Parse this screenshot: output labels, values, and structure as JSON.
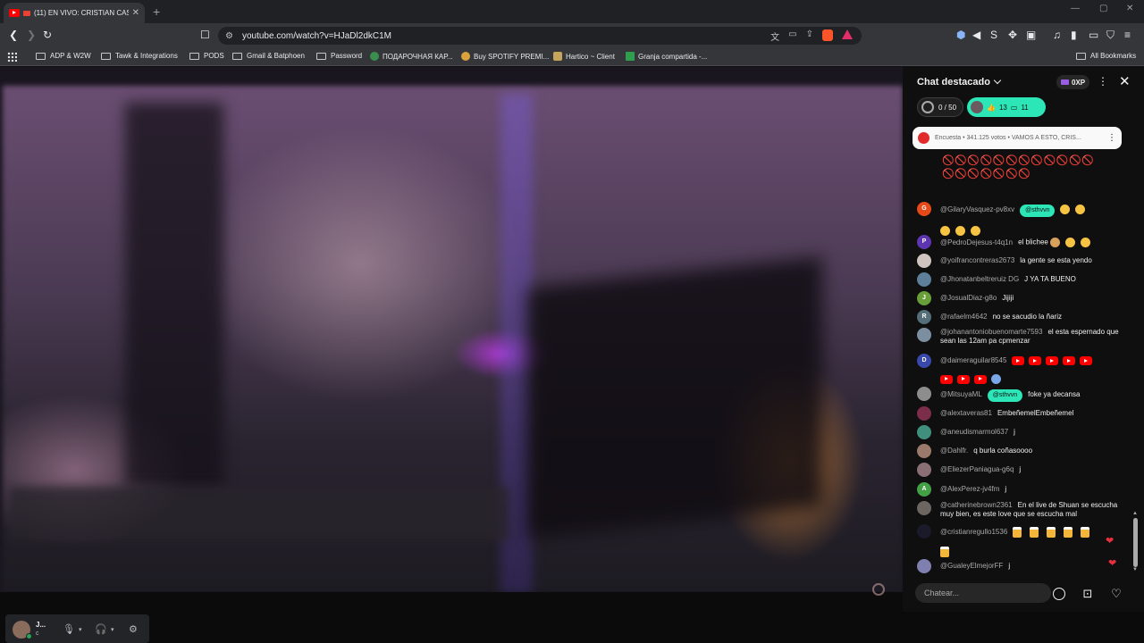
{
  "browser": {
    "tab_title": "(11) EN VIVO: CRISTIAN CASA",
    "url": "youtube.com/watch?v=HJaDl2dkC1M",
    "bookmarks": [
      "ADP & W2W",
      "Tawk & Integrations",
      "PODS",
      "Gmail & Batphoen",
      "Password",
      "ПОДАРОЧНАЯ КАР...",
      "Buy SPOTIFY PREMI...",
      "Hartico ~ Client",
      "Granja compartida -..."
    ],
    "all_bookmarks": "All Bookmarks"
  },
  "chat": {
    "title": "Chat destacado",
    "xp": "0XP",
    "goal": "0 / 50",
    "likes": "13",
    "comments": "11",
    "poll_text": "Encuesta • 341.125 votos • VAMOS A ESTO, CRIS...",
    "banned_row": "🚫🚫🚫🚫🚫🚫🚫🚫🚫🚫🚫🚫🚫🚫🚫🚫🚫🚫🚫",
    "input_placeholder": "Chatear...",
    "messages": [
      {
        "initial": "G",
        "author": "@GilaryVasquez-pv8xv",
        "chip": "@sthvvn",
        "text": "",
        "color": "#e64a19"
      },
      {
        "initial": "P",
        "author": "@PedroDejesus-t4q1n",
        "text": "el blichee",
        "color": "#5e35b1"
      },
      {
        "initial": "",
        "author": "@yoifrancontreras2673",
        "text": "la gente se esta yendo",
        "color": "#cfc4c0"
      },
      {
        "initial": "",
        "author": "@Jhonatanbeltreruiz DG",
        "text": "J YA TA BUENO",
        "color": "#5d7f99"
      },
      {
        "initial": "J",
        "author": "@JosualDiaz-g8o",
        "text": "Jijiji",
        "color": "#689f38"
      },
      {
        "initial": "R",
        "author": "@rafaelm4642",
        "text": "no se sacudio la ñariz",
        "color": "#546e7a"
      },
      {
        "initial": "",
        "author": "@johanantoniobuenomarte7593",
        "text": "el esta espernado que sean las 12am pa cpmenzar",
        "color": "#7c8fa0"
      },
      {
        "initial": "D",
        "author": "@daimeraguilar8545",
        "text": "",
        "color": "#3949ab"
      },
      {
        "initial": "",
        "author": "@MitsuyaML",
        "chip": "@sthvvn",
        "text": "foke ya decansa",
        "color": "#8d8d8d"
      },
      {
        "initial": "",
        "author": "@alextaveras81",
        "text": "EmbeñemelEmbeñemel",
        "color": "#7b2d4a"
      },
      {
        "initial": "",
        "author": "@aneudismarmol637",
        "text": "j",
        "color": "#3f8f7c"
      },
      {
        "initial": "",
        "author": "@Dahlfr.",
        "text": "q burla coñasoooo",
        "color": "#9c7a6b"
      },
      {
        "initial": "",
        "author": "@EliezerPaniagua-g6q",
        "text": "j",
        "color": "#8a6f74"
      },
      {
        "initial": "A",
        "author": "@AlexPerez-jv4fm",
        "text": "j",
        "color": "#43a047"
      },
      {
        "initial": "",
        "author": "@catherinebrown2361",
        "text": "En el live de Shuan se escucha muy bien, es este love que se escucha mal",
        "color": "#6d6560"
      },
      {
        "initial": "",
        "author": "@cristianregullo1536",
        "text": "",
        "color": "#1a1a2a"
      },
      {
        "initial": "",
        "author": "@GualeyElmejorFF",
        "text": "j",
        "color": "#8080b0"
      }
    ]
  },
  "user": {
    "name": "J...",
    "status": "c"
  }
}
